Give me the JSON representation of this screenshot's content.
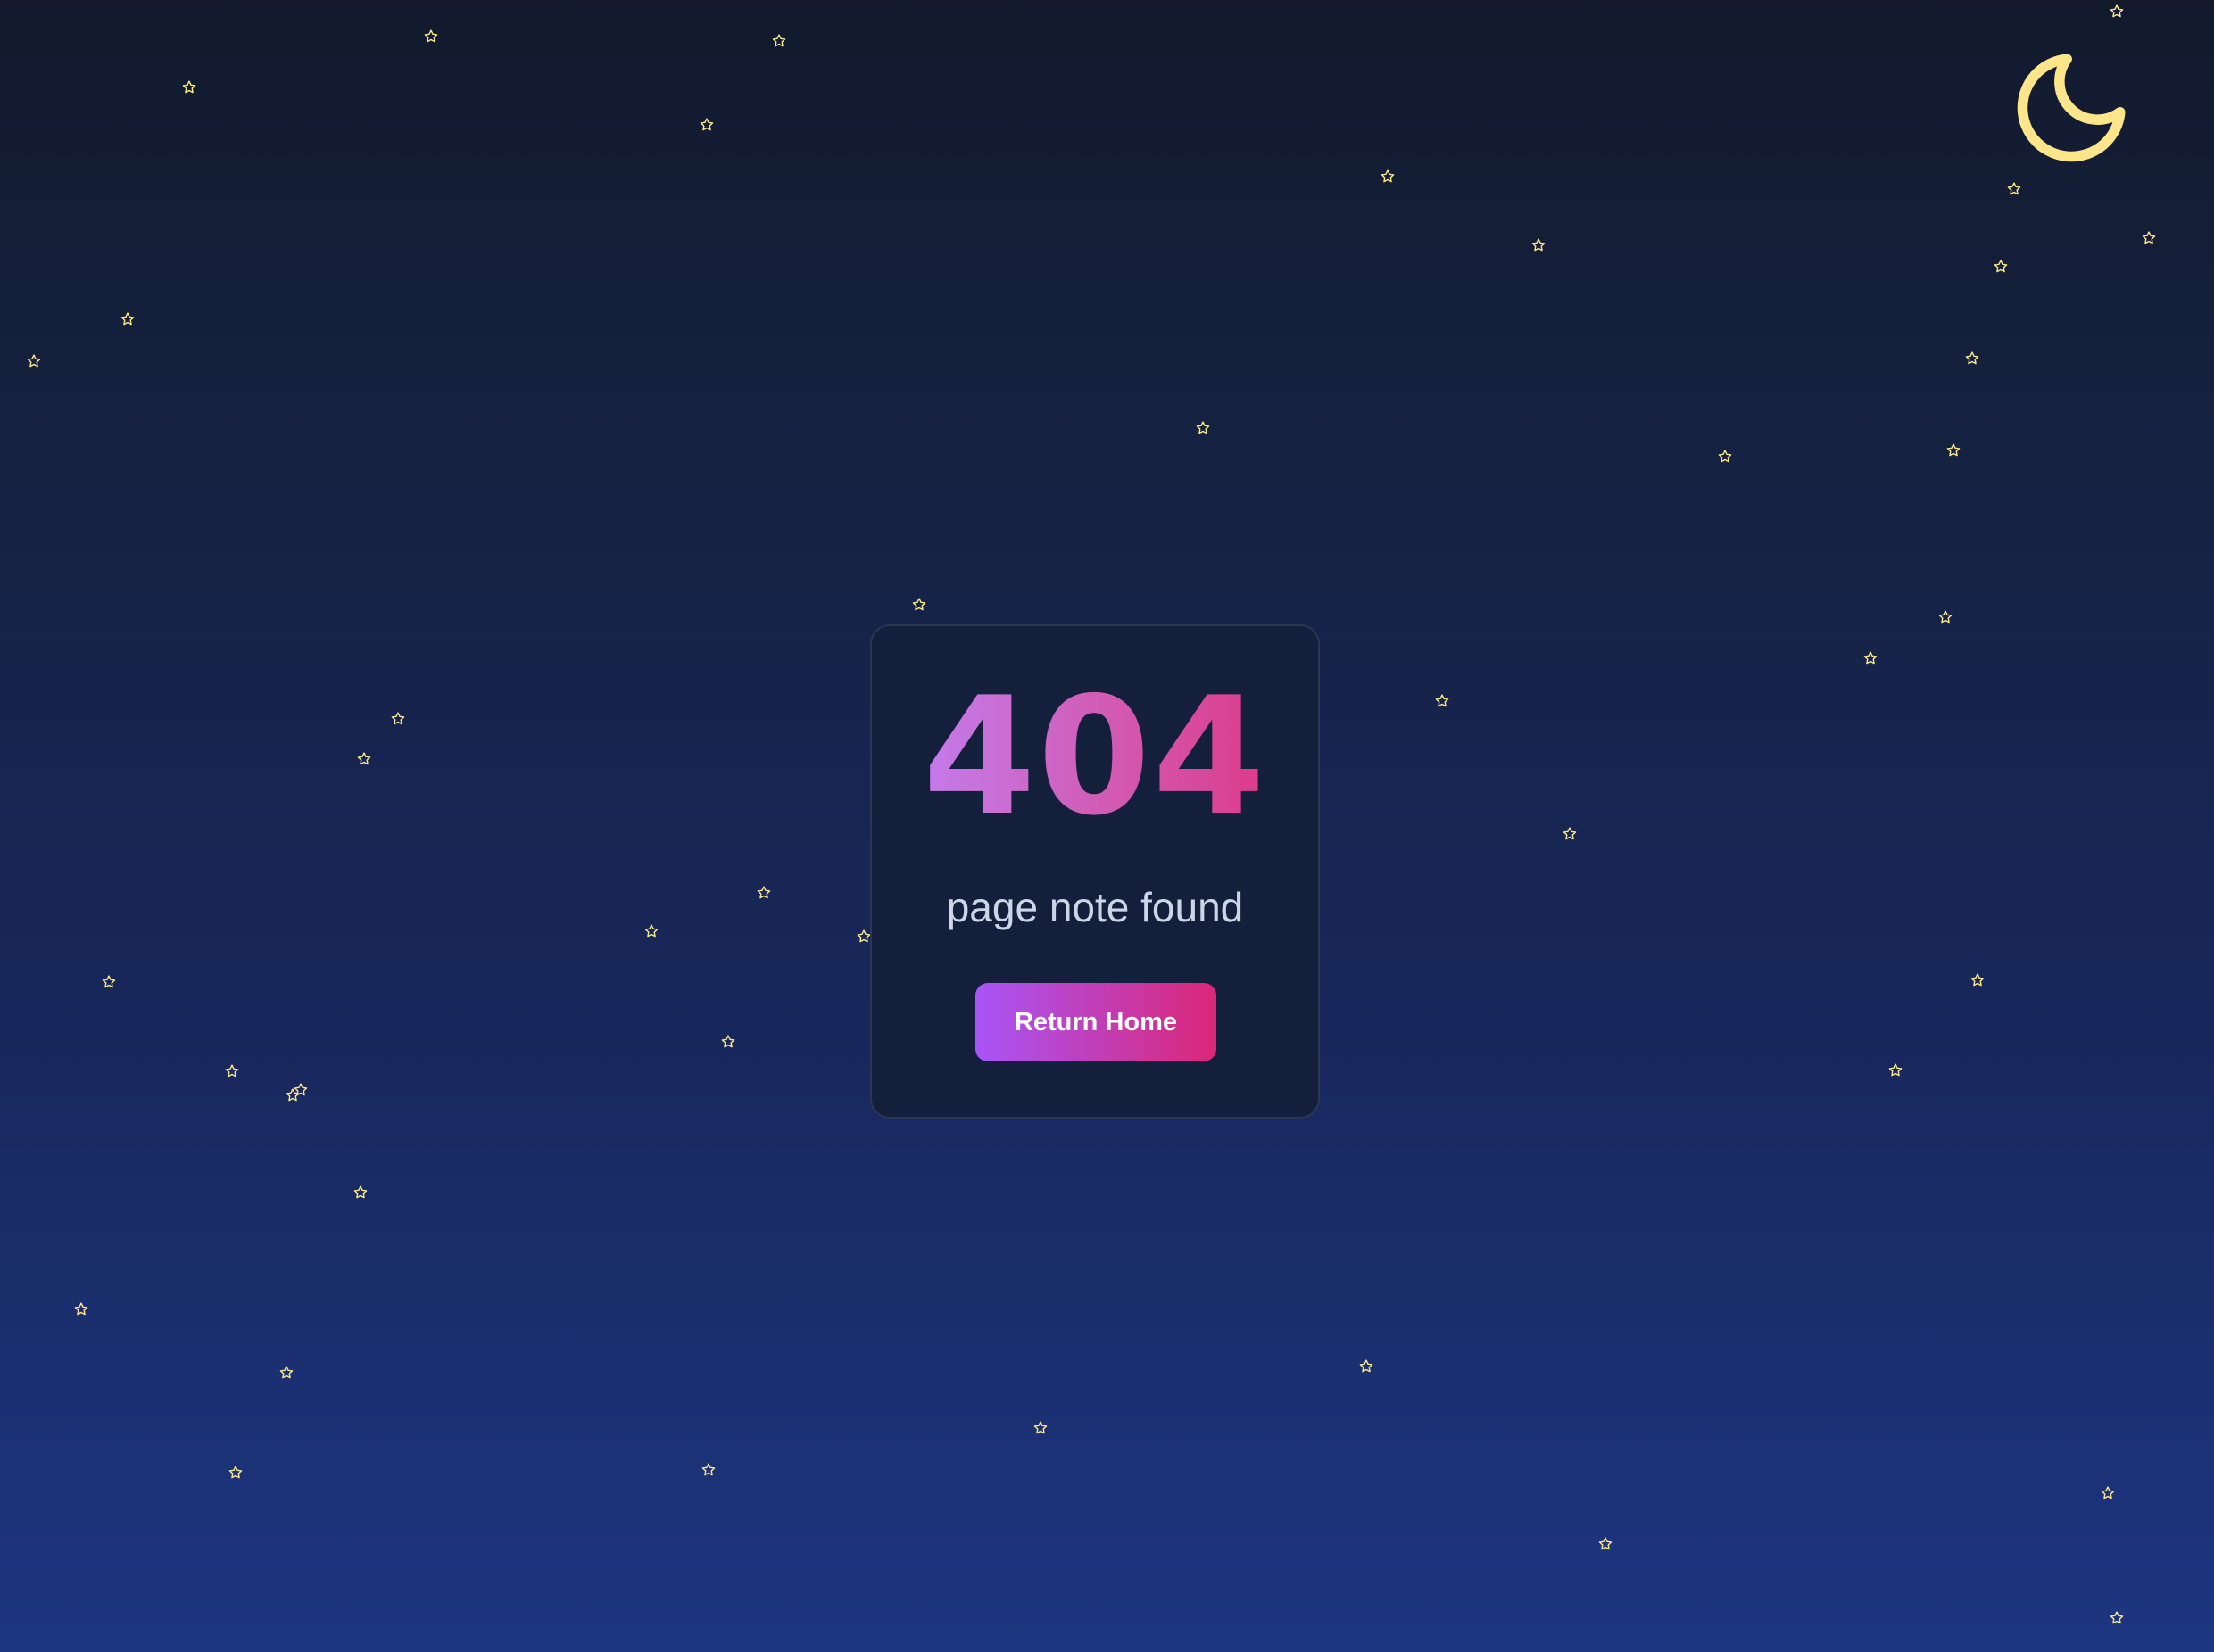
{
  "error": {
    "code": "404",
    "message": "page note found",
    "button_label": "Return Home"
  },
  "icons": {
    "moon": "moon-icon",
    "star": "star-icon"
  },
  "colors": {
    "background_top": "#121a2c",
    "background_bottom": "#1d3682",
    "card": "#141f3c",
    "moon": "#fde68a",
    "star": "#fde68a",
    "accent_start": "#a855f7",
    "accent_end": "#db2777",
    "message_text": "#cdd6e6"
  }
}
